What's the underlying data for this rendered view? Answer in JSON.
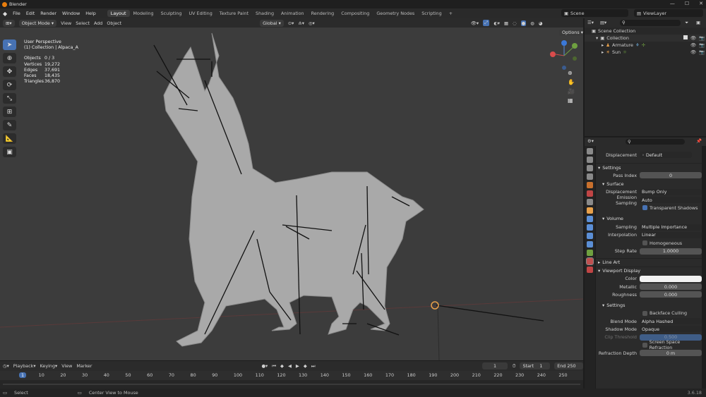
{
  "app": {
    "title": "Blender",
    "version": "3.6.18"
  },
  "menu": [
    "File",
    "Edit",
    "Render",
    "Window",
    "Help"
  ],
  "workspaces": [
    "Layout",
    "Modeling",
    "Sculpting",
    "UV Editing",
    "Texture Paint",
    "Shading",
    "Animation",
    "Rendering",
    "Compositing",
    "Geometry Nodes",
    "Scripting"
  ],
  "active_workspace": "Layout",
  "scene": "Scene",
  "view_layer": "ViewLayer",
  "viewport_header": {
    "mode": "Object Mode",
    "menus": [
      "View",
      "Select",
      "Add",
      "Object"
    ],
    "transform": "Global",
    "options": "Options"
  },
  "overlay": {
    "perspective": "User Perspective",
    "collection": "(1) Collection | Alpaca_A",
    "stats": [
      {
        "k": "Objects",
        "v": "0 / 3"
      },
      {
        "k": "Vertices",
        "v": "19,272"
      },
      {
        "k": "Edges",
        "v": "37,691"
      },
      {
        "k": "Faces",
        "v": "18,435"
      },
      {
        "k": "Triangles",
        "v": "36,870"
      }
    ]
  },
  "gizmo": {
    "x": "X",
    "y": "Y",
    "z": "Z"
  },
  "outliner": {
    "rows": [
      {
        "name": "Scene Collection"
      },
      {
        "name": "Collection"
      },
      {
        "name": "Armature"
      },
      {
        "name": "Sun"
      }
    ]
  },
  "props": {
    "top_label": "Displacement",
    "top_value": "Default",
    "sections": {
      "settings": "Settings",
      "pass_index_label": "Pass Index",
      "pass_index": "0",
      "surface": "Surface",
      "displacement_label": "Displacement",
      "displacement": "Bump Only",
      "emission_label": "Emission Sampling",
      "emission": "Auto",
      "transparent_shadows": "Transparent Shadows",
      "volume": "Volume",
      "sampling_label": "Sampling",
      "sampling": "Multiple Importance",
      "interp_label": "Interpolation",
      "interp": "Linear",
      "homogeneous": "Homogeneous",
      "step_label": "Step Rate",
      "step": "1.0000",
      "line_art": "Line Art",
      "viewport_display": "Viewport Display",
      "color_label": "Color",
      "metallic_label": "Metallic",
      "metallic": "0.000",
      "roughness_label": "Roughness",
      "roughness": "0.000",
      "settings2": "Settings",
      "backface": "Backface Culling",
      "blend_label": "Blend Mode",
      "blend": "Alpha Hashed",
      "shadow_label": "Shadow Mode",
      "shadow": "Opaque",
      "clip_label": "Clip Threshold",
      "clip": "0.500",
      "ssr": "Screen Space Refraction",
      "refraction_label": "Refraction Depth",
      "refraction": "0 m"
    }
  },
  "timeline": {
    "menus": [
      "Playback",
      "Keying",
      "View",
      "Marker"
    ],
    "current": "1",
    "start_label": "Start",
    "start": "1",
    "end_label": "End",
    "end": "250",
    "ticks": [
      "1",
      "10",
      "20",
      "30",
      "40",
      "50",
      "60",
      "70",
      "80",
      "90",
      "100",
      "110",
      "120",
      "130",
      "140",
      "150",
      "160",
      "170",
      "180",
      "190",
      "200",
      "210",
      "220",
      "230",
      "240",
      "250"
    ]
  },
  "status": {
    "select": "Select",
    "center": "Center View to Mouse"
  }
}
